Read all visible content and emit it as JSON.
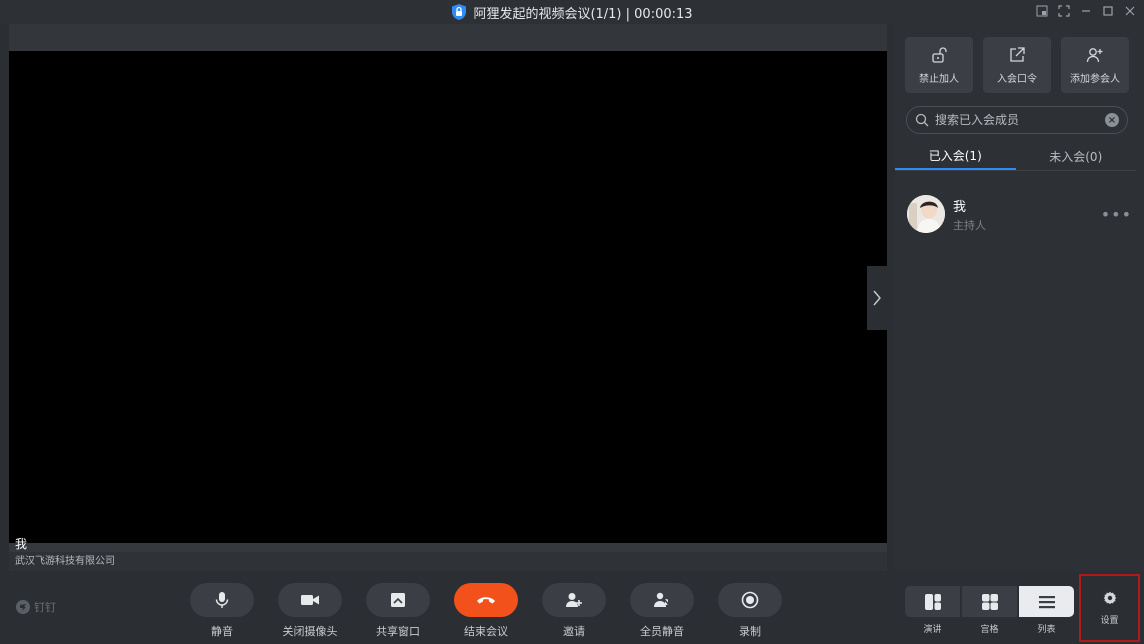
{
  "window": {
    "title": "阿狸发起的视频会议(1/1) | 00:00:13",
    "accent": "#2f8cf5"
  },
  "video": {
    "participant_name": "我",
    "organization": "武汉飞游科技有限公司"
  },
  "sidebar": {
    "actions": [
      {
        "label": "禁止加人",
        "icon": "unlock-icon"
      },
      {
        "label": "入会口令",
        "icon": "share-out-icon"
      },
      {
        "label": "添加参会人",
        "icon": "add-user-icon"
      }
    ],
    "search": {
      "placeholder": "搜索已入会成员"
    },
    "tabs": [
      {
        "label": "已入会(1)",
        "active": true
      },
      {
        "label": "未入会(0)",
        "active": false
      }
    ],
    "members": [
      {
        "name": "我",
        "role": "主持人"
      }
    ]
  },
  "bottom": {
    "brand": "钉钉",
    "controls": [
      {
        "label": "静音",
        "icon": "microphone-icon"
      },
      {
        "label": "关闭摄像头",
        "icon": "camera-icon"
      },
      {
        "label": "共享窗口",
        "icon": "share-screen-icon"
      },
      {
        "label": "结束会议",
        "icon": "hang-up-icon",
        "color": "#f2511b"
      },
      {
        "label": "邀请",
        "icon": "invite-icon"
      },
      {
        "label": "全员静音",
        "icon": "mute-all-icon"
      },
      {
        "label": "录制",
        "icon": "record-icon"
      }
    ],
    "layouts": [
      {
        "label": "演讲",
        "icon": "speaker-layout-icon"
      },
      {
        "label": "宫格",
        "icon": "grid-layout-icon"
      },
      {
        "label": "列表",
        "icon": "list-layout-icon",
        "active": true
      }
    ],
    "settings_label": "设置"
  }
}
